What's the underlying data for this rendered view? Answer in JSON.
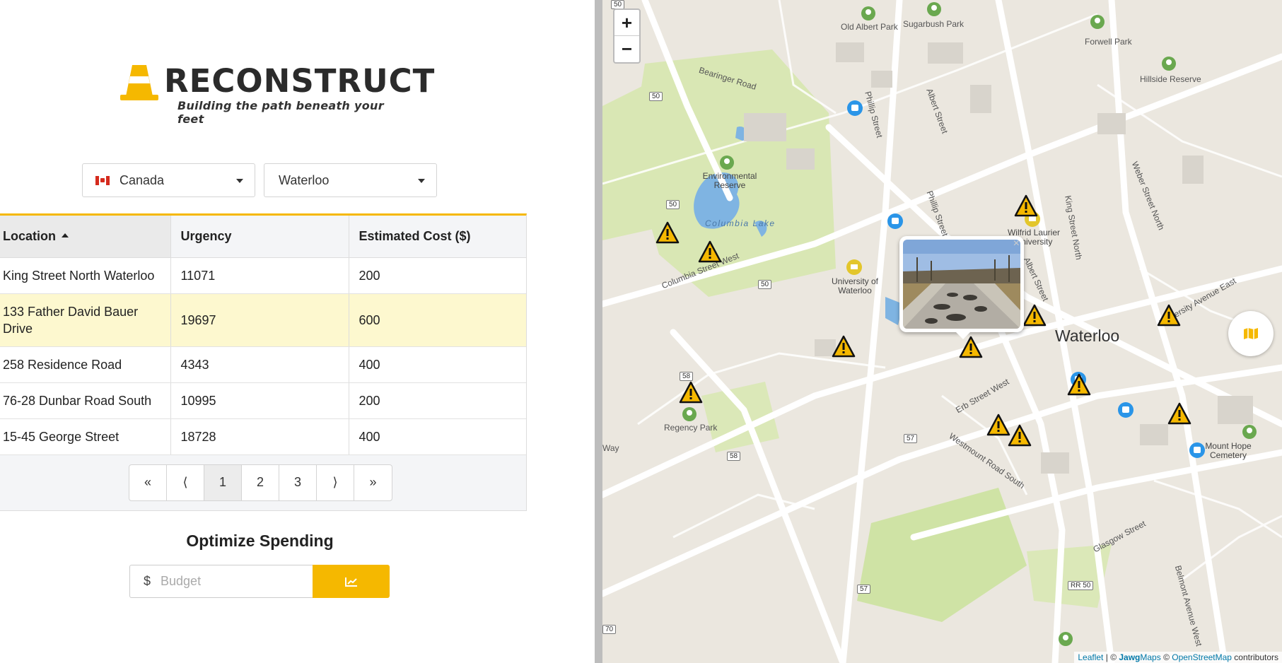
{
  "brand": {
    "name": "RECONSTRUCT",
    "tagline": "Building the path beneath your feet",
    "accent": "#f5b800"
  },
  "filters": {
    "country": "Canada",
    "city": "Waterloo"
  },
  "table": {
    "headers": [
      "Location",
      "Urgency",
      "Estimated Cost ($)"
    ],
    "rows": [
      {
        "location": "King Street North Waterloo",
        "urgency": "11071",
        "cost": "200"
      },
      {
        "location": "133 Father David Bauer Drive",
        "urgency": "19697",
        "cost": "600"
      },
      {
        "location": "258 Residence Road",
        "urgency": "4343",
        "cost": "400"
      },
      {
        "location": "76-28 Dunbar Road South",
        "urgency": "10995",
        "cost": "200"
      },
      {
        "location": "15-45 George Street",
        "urgency": "18728",
        "cost": "400"
      }
    ],
    "pagination": [
      "«",
      "⟨",
      "1",
      "2",
      "3",
      "⟩",
      "»"
    ]
  },
  "optimize": {
    "title": "Optimize Spending",
    "currency": "$",
    "placeholder": "Budget"
  },
  "map": {
    "zoom_in": "+",
    "zoom_out": "−",
    "city_label": "Waterloo",
    "labels": {
      "old_albert_park": "Old Albert Park",
      "sugarbush_park": "Sugarbush Park",
      "forwell_park": "Forwell Park",
      "hillside_reserve": "Hillside Reserve",
      "bearinger": "Bearinger Road",
      "phillip1": "Phillip Street",
      "albert1": "Albert Street",
      "env_reserve": "Environmental Reserve",
      "columbia_lake": "Columbia Lake",
      "columbia_west": "Columbia Street West",
      "uw": "University of Waterloo",
      "wlu": "Wilfrid Laurier University",
      "weber": "Weber Street North",
      "king": "King Street North",
      "albert2": "Albert Street",
      "phillip2": "Phillip Street",
      "regency": "Regency Park",
      "erb": "Erb Street West",
      "westmount": "Westmount Road South",
      "glasgow": "Glasgow Street",
      "belmont": "Belmont Avenue West",
      "mount_hope": "Mount Hope Cemetery",
      "university_east": "University Avenue East",
      "way": "Way"
    },
    "shields": [
      "50",
      "50",
      "50",
      "58",
      "58",
      "57",
      "57",
      "RR 50",
      "70",
      "50"
    ],
    "attribution": {
      "leaflet": "Leaflet",
      "jawg_prefix": "© ",
      "jawg": "Jawg",
      "maps": "Maps",
      "osm_prefix": " © ",
      "osm": "OpenStreetMap",
      "suffix": " contributors",
      "sep": " | "
    },
    "marker_count": 16
  }
}
